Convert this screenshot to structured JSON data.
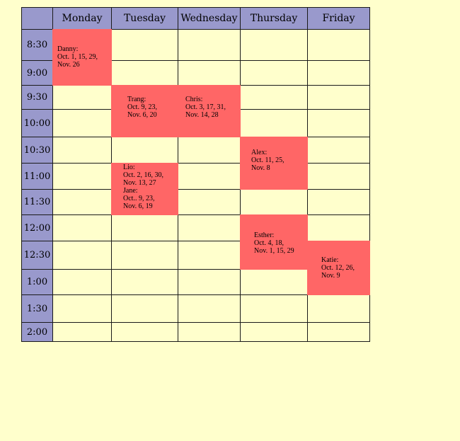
{
  "days": [
    "Monday",
    "Tuesday",
    "Wednesday",
    "Thursday",
    "Friday"
  ],
  "times": [
    "8:30",
    "9:00",
    "9:30",
    "10:00",
    "10:30",
    "11:00",
    "11:30",
    "12:00",
    "12:30",
    "1:00",
    "1:30",
    "2:00"
  ],
  "appointments": [
    {
      "text": "Danny:\nOct. 1, 15, 29,\nNov. 26",
      "color": "#ff6666"
    },
    {
      "text": "Trang:\nOct. 9, 23,\nNov. 6, 20",
      "color": "#ff6666"
    },
    {
      "text": "Chris:\nOct. 3, 17, 31,\nNov. 14, 28",
      "color": "#ff6666"
    },
    {
      "text": "Alex:\nOct. 11, 25,\nNov. 8",
      "color": "#ff6666"
    },
    {
      "text": "Lio:\nOct. 2, 16, 30,\nNov. 13, 27\nJane:\nOct.. 9, 23,\nNov. 6, 19",
      "color": "#ff6666"
    },
    {
      "text": "Esther:\nOct. 4, 18,\nNov. 1, 15, 29",
      "color": "#ff6666"
    },
    {
      "text": "Katie:\nOct. 12, 26,\nNov. 9",
      "color": "#ff6666"
    }
  ],
  "colors": {
    "background": "#ffffcc",
    "header": "#9999cc",
    "booked": "#ff6666",
    "grid_line": "#1a1a1a"
  }
}
